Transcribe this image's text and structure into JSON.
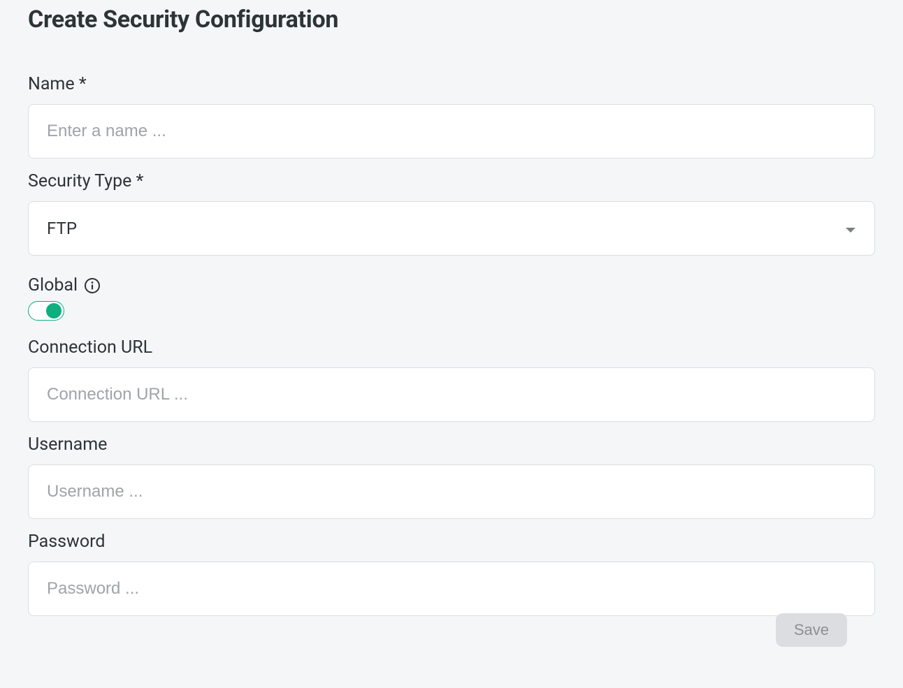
{
  "page": {
    "title": "Create Security Configuration"
  },
  "fields": {
    "name": {
      "label": "Name *",
      "placeholder": "Enter a name ...",
      "value": ""
    },
    "security_type": {
      "label": "Security Type *",
      "selected": "FTP"
    },
    "global": {
      "label": "Global",
      "on": true
    },
    "connection_url": {
      "label": "Connection URL",
      "placeholder": "Connection URL ...",
      "value": ""
    },
    "username": {
      "label": "Username",
      "placeholder": "Username ...",
      "value": ""
    },
    "password": {
      "label": "Password",
      "placeholder": "Password ...",
      "value": ""
    }
  },
  "actions": {
    "save": "Save"
  }
}
